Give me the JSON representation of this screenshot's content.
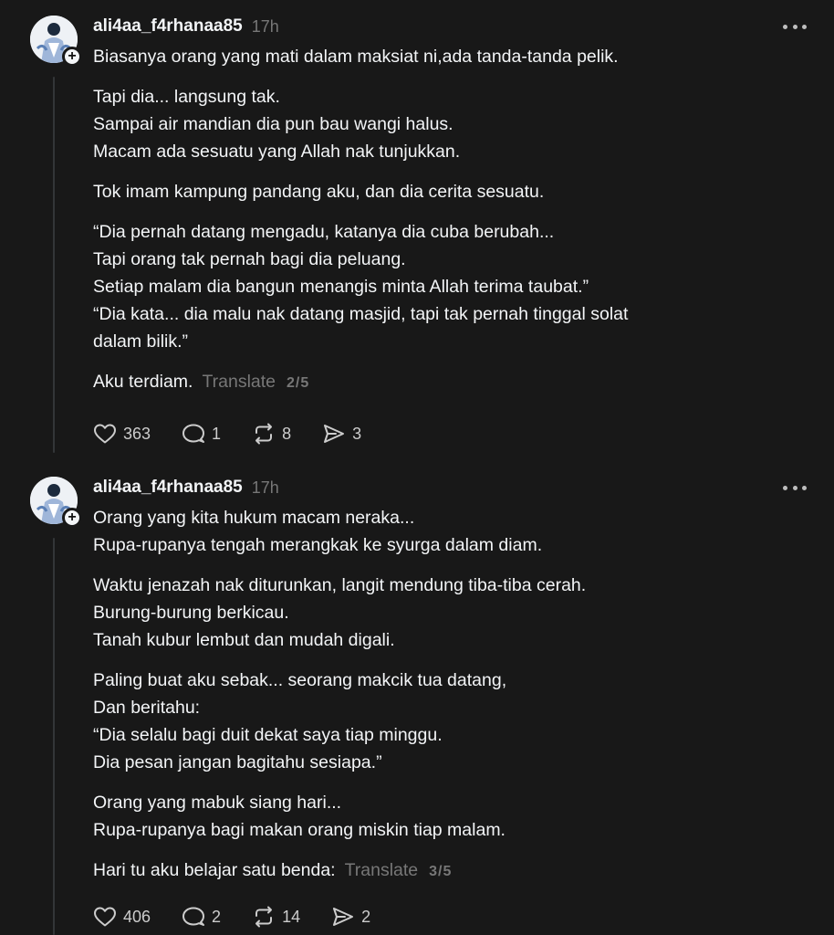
{
  "posts": [
    {
      "username": "ali4aa_f4rhanaa85",
      "time": "17h",
      "paragraphs": [
        [
          "Biasanya orang yang mati dalam maksiat ni,ada tanda-tanda pelik."
        ],
        [
          "Tapi dia... langsung tak.",
          "Sampai air mandian dia pun bau wangi halus.",
          "Macam ada sesuatu yang Allah nak tunjukkan."
        ],
        [
          "Tok imam kampung pandang aku, dan dia cerita sesuatu."
        ],
        [
          "“Dia pernah datang mengadu, katanya dia cuba berubah...",
          "Tapi orang tak pernah bagi dia peluang.",
          "Setiap malam dia bangun menangis minta Allah terima taubat.”",
          "“Dia kata... dia malu nak datang masjid, tapi tak pernah tinggal solat",
          "dalam bilik.”"
        ]
      ],
      "last_line": "Aku terdiam.",
      "translate": "Translate",
      "pager": "2/5",
      "likes": "363",
      "replies": "1",
      "reposts": "8",
      "shares": "3"
    },
    {
      "username": "ali4aa_f4rhanaa85",
      "time": "17h",
      "paragraphs": [
        [
          "Orang yang kita hukum macam neraka...",
          "Rupa-rupanya tengah merangkak ke syurga dalam diam."
        ],
        [
          "Waktu jenazah nak diturunkan, langit mendung tiba-tiba cerah.",
          "Burung-burung berkicau.",
          "Tanah kubur lembut dan mudah digali."
        ],
        [
          "Paling buat aku sebak... seorang makcik tua datang,",
          "Dan beritahu:",
          "“Dia selalu bagi duit dekat saya tiap minggu.",
          "Dia pesan jangan bagitahu sesiapa.”"
        ],
        [
          "Orang yang mabuk siang hari...",
          "Rupa-rupanya bagi makan orang miskin tiap malam."
        ]
      ],
      "last_line": "Hari tu aku belajar satu benda:",
      "translate": "Translate",
      "pager": "3/5",
      "likes": "406",
      "replies": "2",
      "reposts": "14",
      "shares": "2"
    }
  ],
  "icons": {
    "like": "heart-icon",
    "reply": "comment-icon",
    "repost": "repost-icon",
    "share": "send-icon",
    "more": "more-icon",
    "follow": "plus-icon"
  }
}
